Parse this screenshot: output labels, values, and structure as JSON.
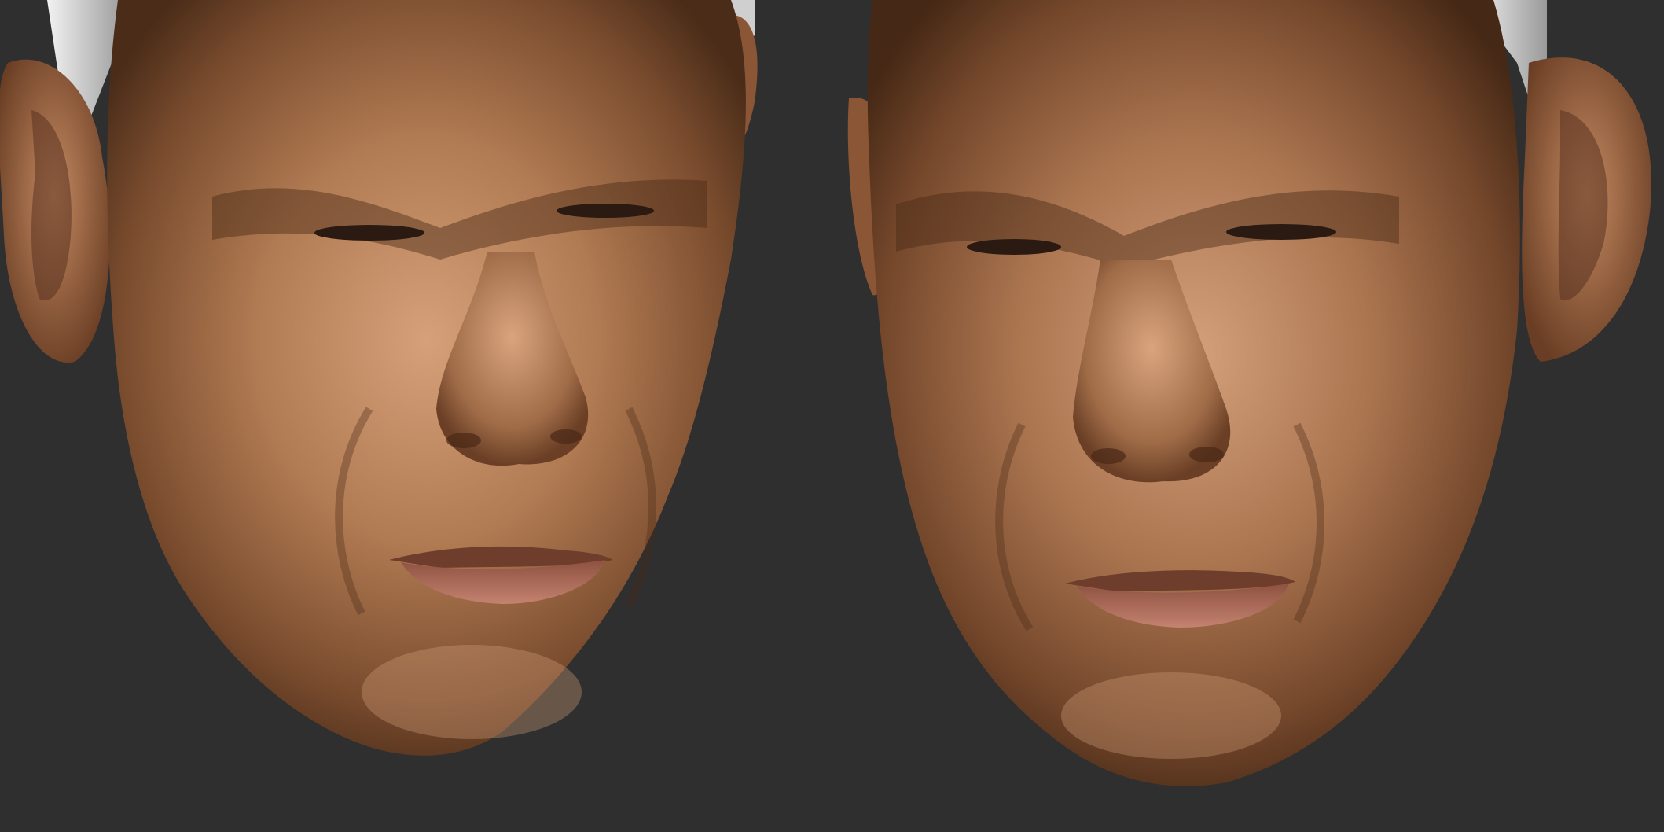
{
  "scene": {
    "description_type": "3d-sculpt-render",
    "background_color": "#2f2f2f",
    "skin_base": "#b07a52",
    "skin_shadow": "#5a3520",
    "skin_highlight": "#d9a27a",
    "lip_color": "#b8705e",
    "cap_color": "#d9d9d9",
    "views": [
      {
        "name": "left-three-quarter"
      },
      {
        "name": "right-three-quarter"
      }
    ]
  }
}
